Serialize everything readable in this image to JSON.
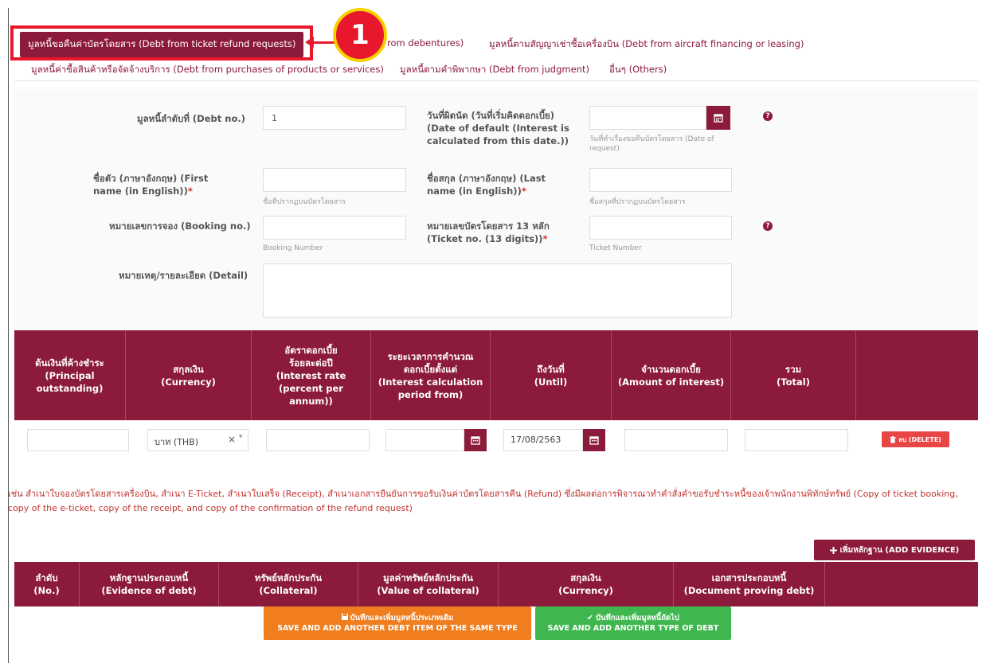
{
  "tabs": [
    {
      "label": "มูลหนี้ขอคืนค่าบัตรโดยสาร (Debt from ticket refund requests)",
      "active": true
    },
    {
      "label": "มูลหนี้ตามหุ้นกู้ (Debt from debentures)",
      "visible_text": "rom debentures)"
    },
    {
      "label": "มูลหนี้ตามสัญญาเช่าซื้อเครื่องบิน (Debt from aircraft financing or leasing)"
    },
    {
      "label": "มูลหนี้ค่าซื้อสินค้าหรือจัดจ้างบริการ (Debt from purchases of products or services)"
    },
    {
      "label": "มูลหนี้ตามคำพิพากษา (Debt from judgment)"
    },
    {
      "label": "อื่นๆ (Others)"
    }
  ],
  "callout": {
    "number": "1"
  },
  "form": {
    "debt_no_label": "มูลหนี้ลำดับที่ (Debt no.)",
    "debt_no_value": "1",
    "default_date_label_1": "วันที่ผิดนัด (วันที่เริ่มคิดดอกเบี้ย)",
    "default_date_label_2": "(Date of default (Interest is",
    "default_date_label_3": "calculated from this date.))",
    "default_date_hint_1": "วันที่ทำเรื่องขอคืนบัตรโดยสาร (Date of",
    "default_date_hint_2": "request)",
    "first_name_label_1": "ชื่อตัว (ภาษาอังกฤษ) (First",
    "first_name_label_2": "name (in English))",
    "first_name_hint": "ชื่อที่ปรากฏบนบัตรโดยสาร",
    "last_name_label_1": "ชื่อสกุล (ภาษาอังกฤษ) (Last",
    "last_name_label_2": "name (in English))",
    "last_name_hint": "ชื่อสกุลที่ปรากฏบนบัตรโดยสาร",
    "booking_label": "หมายเลขการจอง (Booking no.)",
    "booking_hint": "Booking Number",
    "ticket_label_1": "หมายเลขบัตรโดยสาร 13 หลัก",
    "ticket_label_2": "(Ticket no. (13 digits))",
    "ticket_hint": "Ticket Number",
    "detail_label": "หมายเหตุ/รายละเอียด (Detail)",
    "required_mark": "*",
    "help_glyph": "?",
    "calendar_icon": "calendar-icon"
  },
  "interest_table": {
    "headers": [
      {
        "th": "ต้นเงินที่ค้างชำระ",
        "en1": "(Principal",
        "en2": "outstanding)"
      },
      {
        "th": "สกุลเงิน",
        "en1": "(Currency)",
        "en2": ""
      },
      {
        "th": "อัตราดอกเบี้ย",
        "th2": "ร้อยละต่อปี",
        "en1": "(Interest rate",
        "en2": "(percent per",
        "en3": "annum))"
      },
      {
        "th": "ระยะเวลาการคำนวณ",
        "th2": "ดอกเบี้ยตั้งแต่",
        "en1": "(Interest calculation",
        "en2": "period from)"
      },
      {
        "th": "ถึงวันที่",
        "en1": "(Until)",
        "en2": ""
      },
      {
        "th": "จำนวนดอกเบี้ย",
        "en1": "(Amount of interest)",
        "en2": ""
      },
      {
        "th": "รวม",
        "en1": "(Total)",
        "en2": ""
      },
      {
        "th": "",
        "en1": "",
        "en2": ""
      }
    ],
    "row": {
      "currency": "บาท (THB)",
      "clear_glyph": "×",
      "dropdown_glyph": "▾",
      "until_date": "17/08/2563",
      "delete_label": "ลบ (DELETE)"
    }
  },
  "note_text": "เช่น สำเนาใบจองบัตรโดยสารเครื่องบิน, สำเนา E-Ticket, สำเนาใบเสร็จ (Receipt), สำเนาเอกสารยืนยันการขอรับเงินค่าบัตรโดยสารคืน (Refund) ซึ่งมีผลต่อการพิจารณาทำคำสั่งคำขอรับชำระหนี้ของเจ้าพนักงานพิทักษ์ทรัพย์ (Copy of ticket booking, copy of the e-ticket, copy of the receipt, and copy of the confirmation of the refund request)",
  "add_evidence_label": "เพิ่มหลักฐาน (ADD EVIDENCE)",
  "evidence_table": {
    "headers": [
      {
        "th": "ลำดับ",
        "en": "(No.)"
      },
      {
        "th": "หลักฐานประกอบหนี้",
        "en": "(Evidence of debt)"
      },
      {
        "th": "ทรัพย์หลักประกัน",
        "en": "(Collateral)"
      },
      {
        "th": "มูลค่าทรัพย์หลักประกัน",
        "en": "(Value of collateral)"
      },
      {
        "th": "สกุลเงิน",
        "en": "(Currency)"
      },
      {
        "th": "เอกสารประกอบหนี้",
        "en": "(Document proving debt)"
      },
      {
        "th": "",
        "en": ""
      }
    ]
  },
  "buttons": {
    "save_same_th": "บันทึกและเพิ่มมูลหนี้ประเภทเดิม",
    "save_same_en": "SAVE AND ADD ANOTHER DEBT ITEM OF THE SAME TYPE",
    "save_other_th": "บันทึกและเพิ่มมูลหนี้ถัดไป",
    "save_other_en": "SAVE AND ADD ANOTHER TYPE OF DEBT"
  },
  "colors": {
    "primary": "#8c1a3a",
    "highlight": "#e8172b",
    "orange": "#f07d1e",
    "green": "#3fb74e"
  }
}
